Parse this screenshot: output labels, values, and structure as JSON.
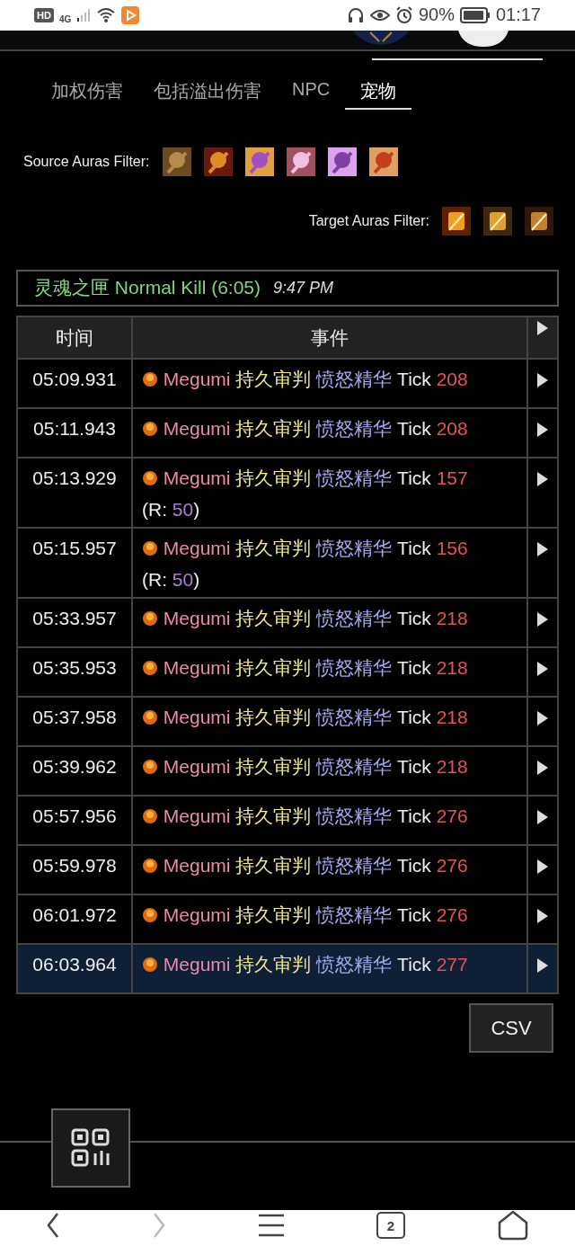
{
  "status_bar": {
    "hd": "HD",
    "network": "4G",
    "battery": "90%",
    "time": "01:17"
  },
  "tabs": [
    {
      "label": "加权伤害",
      "selected": false
    },
    {
      "label": "包括溢出伤害",
      "selected": false
    },
    {
      "label": "NPC",
      "selected": false
    },
    {
      "label": "宠物",
      "selected": true
    }
  ],
  "source_filter": {
    "label": "Source Auras Filter:"
  },
  "target_filter": {
    "label": "Target Auras Filter:"
  },
  "fight": {
    "name": "灵魂之匣 Normal Kill (6:05)",
    "time": "9:47 PM"
  },
  "table": {
    "columns": [
      "时间",
      "事件"
    ],
    "rows": [
      {
        "time": "05:09.931",
        "source": "Megumi",
        "ability": "持久审判",
        "target": "愤怒精华",
        "type": "Tick",
        "amount": "208",
        "selected": false
      },
      {
        "time": "05:11.943",
        "source": "Megumi",
        "ability": "持久审判",
        "target": "愤怒精华",
        "type": "Tick",
        "amount": "208",
        "selected": false
      },
      {
        "time": "05:13.929",
        "source": "Megumi",
        "ability": "持久审判",
        "target": "愤怒精华",
        "type": "Tick",
        "amount": "157",
        "resist": {
          "before": "(R: ",
          "value": "50",
          "after": ")"
        },
        "selected": false
      },
      {
        "time": "05:15.957",
        "source": "Megumi",
        "ability": "持久审判",
        "target": "愤怒精华",
        "type": "Tick",
        "amount": "156",
        "resist": {
          "before": "(R: ",
          "value": "50",
          "after": ")"
        },
        "selected": false
      },
      {
        "time": "05:33.957",
        "source": "Megumi",
        "ability": "持久审判",
        "target": "愤怒精华",
        "type": "Tick",
        "amount": "218",
        "selected": false
      },
      {
        "time": "05:35.953",
        "source": "Megumi",
        "ability": "持久审判",
        "target": "愤怒精华",
        "type": "Tick",
        "amount": "218",
        "selected": false
      },
      {
        "time": "05:37.958",
        "source": "Megumi",
        "ability": "持久审判",
        "target": "愤怒精华",
        "type": "Tick",
        "amount": "218",
        "selected": false
      },
      {
        "time": "05:39.962",
        "source": "Megumi",
        "ability": "持久审判",
        "target": "愤怒精华",
        "type": "Tick",
        "amount": "218",
        "selected": false
      },
      {
        "time": "05:57.956",
        "source": "Megumi",
        "ability": "持久审判",
        "target": "愤怒精华",
        "type": "Tick",
        "amount": "276",
        "selected": false
      },
      {
        "time": "05:59.978",
        "source": "Megumi",
        "ability": "持久审判",
        "target": "愤怒精华",
        "type": "Tick",
        "amount": "276",
        "selected": false
      },
      {
        "time": "06:01.972",
        "source": "Megumi",
        "ability": "持久审判",
        "target": "愤怒精华",
        "type": "Tick",
        "amount": "276",
        "selected": false
      },
      {
        "time": "06:03.964",
        "source": "Megumi",
        "ability": "持久审判",
        "target": "愤怒精华",
        "type": "Tick",
        "amount": "277",
        "selected": true
      }
    ]
  },
  "csv_button": "CSV",
  "nav": {
    "tab_count": "2"
  }
}
